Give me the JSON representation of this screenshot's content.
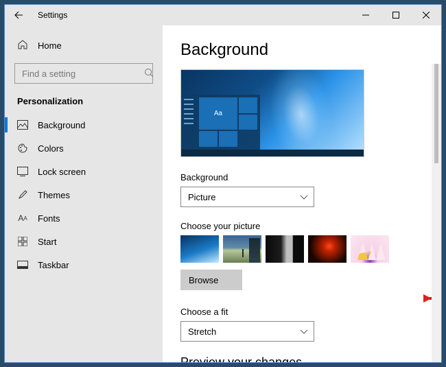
{
  "window": {
    "title": "Settings"
  },
  "sidebar": {
    "home": "Home",
    "search_placeholder": "Find a setting",
    "section": "Personalization",
    "items": [
      {
        "label": "Background",
        "active": true
      },
      {
        "label": "Colors"
      },
      {
        "label": "Lock screen"
      },
      {
        "label": "Themes"
      },
      {
        "label": "Fonts"
      },
      {
        "label": "Start"
      },
      {
        "label": "Taskbar"
      }
    ]
  },
  "content": {
    "heading": "Background",
    "preview_tile_text": "Aa",
    "background_label": "Background",
    "background_value": "Picture",
    "choose_picture_label": "Choose your picture",
    "browse_label": "Browse",
    "choose_fit_label": "Choose a fit",
    "fit_value": "Stretch",
    "preview_changes": "Preview your changes"
  },
  "annotation": {
    "arrow_color": "#e51c1c"
  }
}
